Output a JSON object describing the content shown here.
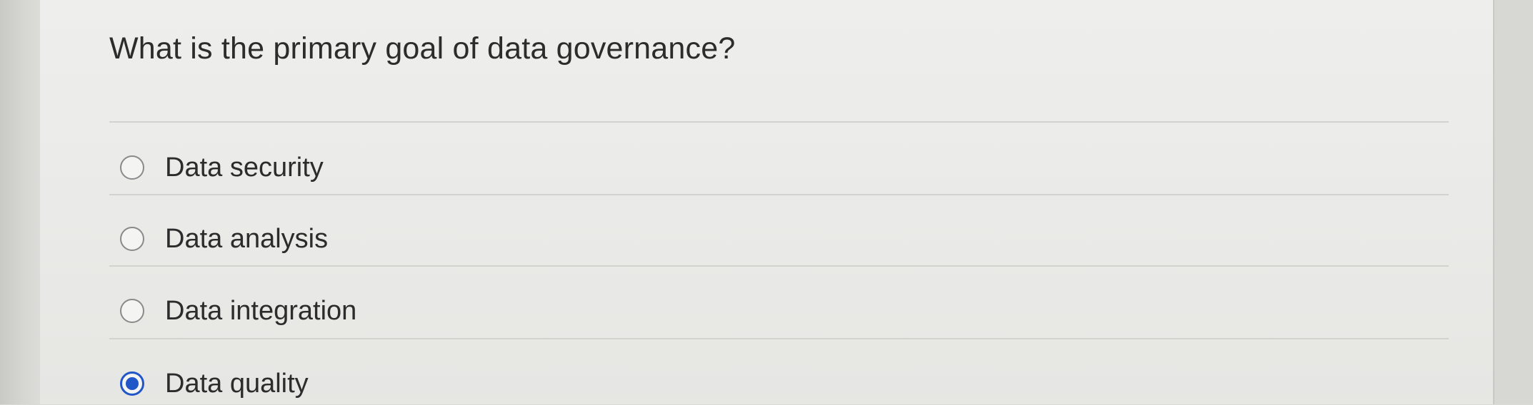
{
  "question": {
    "text": "What is the primary goal of data governance?"
  },
  "options": [
    {
      "label": "Data security",
      "selected": false
    },
    {
      "label": "Data analysis",
      "selected": false
    },
    {
      "label": "Data integration",
      "selected": false
    },
    {
      "label": "Data quality",
      "selected": true
    }
  ],
  "colors": {
    "selected_radio": "#2156c9",
    "text": "#2c2c2c",
    "panel_background": "#ececea"
  }
}
